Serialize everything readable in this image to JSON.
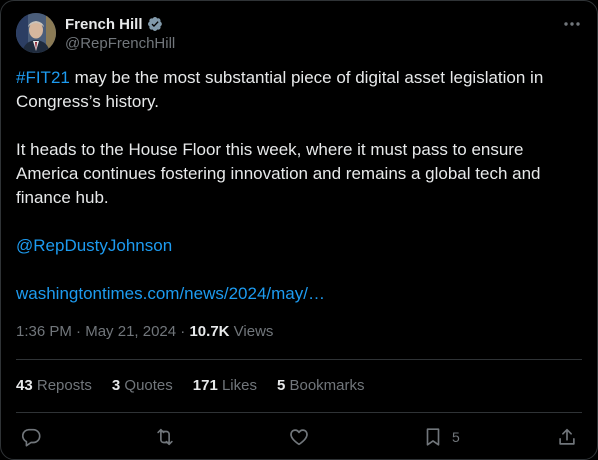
{
  "author": {
    "display_name": "French Hill",
    "handle": "@RepFrenchHill",
    "verified_icon": "verified-badge-icon",
    "avatar": "profile-avatar"
  },
  "tweet": {
    "hashtag": "#FIT21",
    "line1_rest": " may be the most substantial piece of digital asset legislation in Congress’s history.",
    "paragraph2": "It heads to the House Floor this week, where it must pass to ensure America continues fostering innovation and remains a global tech and finance hub.",
    "mention": "@RepDustyJohnson",
    "link": "washingtontimes.com/news/2024/may/…"
  },
  "meta": {
    "time": "1:36 PM",
    "sep1": " · ",
    "date": "May 21, 2024",
    "sep2": " · ",
    "views_count": "10.7K",
    "views_label": " Views"
  },
  "stats": {
    "reposts_count": "43",
    "reposts_label": " Reposts",
    "quotes_count": "3",
    "quotes_label": " Quotes",
    "likes_count": "171",
    "likes_label": " Likes",
    "bookmarks_count": "5",
    "bookmarks_label": " Bookmarks"
  },
  "actions": {
    "bookmark_count": "5",
    "icons": [
      "reply-icon",
      "repost-icon",
      "like-icon",
      "bookmark-icon",
      "share-icon"
    ]
  },
  "colors": {
    "background": "#000000",
    "text": "#e7e9ea",
    "muted": "#71767b",
    "link": "#1d9bf0",
    "border": "#2f3336"
  }
}
